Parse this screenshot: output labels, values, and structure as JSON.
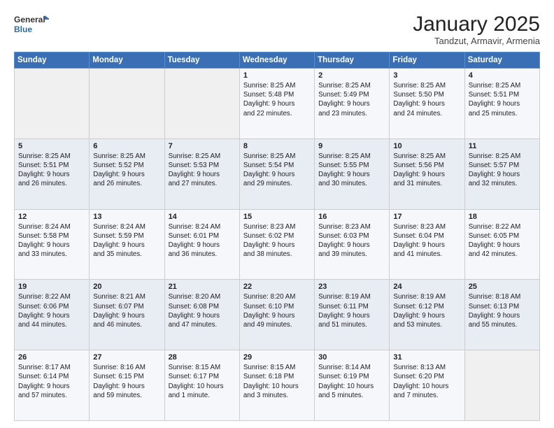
{
  "header": {
    "logo_line1": "General",
    "logo_line2": "Blue",
    "title": "January 2025",
    "subtitle": "Tandzut, Armavir, Armenia"
  },
  "weekdays": [
    "Sunday",
    "Monday",
    "Tuesday",
    "Wednesday",
    "Thursday",
    "Friday",
    "Saturday"
  ],
  "weeks": [
    [
      {
        "day": "",
        "info": ""
      },
      {
        "day": "",
        "info": ""
      },
      {
        "day": "",
        "info": ""
      },
      {
        "day": "1",
        "info": "Sunrise: 8:25 AM\nSunset: 5:48 PM\nDaylight: 9 hours\nand 22 minutes."
      },
      {
        "day": "2",
        "info": "Sunrise: 8:25 AM\nSunset: 5:49 PM\nDaylight: 9 hours\nand 23 minutes."
      },
      {
        "day": "3",
        "info": "Sunrise: 8:25 AM\nSunset: 5:50 PM\nDaylight: 9 hours\nand 24 minutes."
      },
      {
        "day": "4",
        "info": "Sunrise: 8:25 AM\nSunset: 5:51 PM\nDaylight: 9 hours\nand 25 minutes."
      }
    ],
    [
      {
        "day": "5",
        "info": "Sunrise: 8:25 AM\nSunset: 5:51 PM\nDaylight: 9 hours\nand 26 minutes."
      },
      {
        "day": "6",
        "info": "Sunrise: 8:25 AM\nSunset: 5:52 PM\nDaylight: 9 hours\nand 26 minutes."
      },
      {
        "day": "7",
        "info": "Sunrise: 8:25 AM\nSunset: 5:53 PM\nDaylight: 9 hours\nand 27 minutes."
      },
      {
        "day": "8",
        "info": "Sunrise: 8:25 AM\nSunset: 5:54 PM\nDaylight: 9 hours\nand 29 minutes."
      },
      {
        "day": "9",
        "info": "Sunrise: 8:25 AM\nSunset: 5:55 PM\nDaylight: 9 hours\nand 30 minutes."
      },
      {
        "day": "10",
        "info": "Sunrise: 8:25 AM\nSunset: 5:56 PM\nDaylight: 9 hours\nand 31 minutes."
      },
      {
        "day": "11",
        "info": "Sunrise: 8:25 AM\nSunset: 5:57 PM\nDaylight: 9 hours\nand 32 minutes."
      }
    ],
    [
      {
        "day": "12",
        "info": "Sunrise: 8:24 AM\nSunset: 5:58 PM\nDaylight: 9 hours\nand 33 minutes."
      },
      {
        "day": "13",
        "info": "Sunrise: 8:24 AM\nSunset: 5:59 PM\nDaylight: 9 hours\nand 35 minutes."
      },
      {
        "day": "14",
        "info": "Sunrise: 8:24 AM\nSunset: 6:01 PM\nDaylight: 9 hours\nand 36 minutes."
      },
      {
        "day": "15",
        "info": "Sunrise: 8:23 AM\nSunset: 6:02 PM\nDaylight: 9 hours\nand 38 minutes."
      },
      {
        "day": "16",
        "info": "Sunrise: 8:23 AM\nSunset: 6:03 PM\nDaylight: 9 hours\nand 39 minutes."
      },
      {
        "day": "17",
        "info": "Sunrise: 8:23 AM\nSunset: 6:04 PM\nDaylight: 9 hours\nand 41 minutes."
      },
      {
        "day": "18",
        "info": "Sunrise: 8:22 AM\nSunset: 6:05 PM\nDaylight: 9 hours\nand 42 minutes."
      }
    ],
    [
      {
        "day": "19",
        "info": "Sunrise: 8:22 AM\nSunset: 6:06 PM\nDaylight: 9 hours\nand 44 minutes."
      },
      {
        "day": "20",
        "info": "Sunrise: 8:21 AM\nSunset: 6:07 PM\nDaylight: 9 hours\nand 46 minutes."
      },
      {
        "day": "21",
        "info": "Sunrise: 8:20 AM\nSunset: 6:08 PM\nDaylight: 9 hours\nand 47 minutes."
      },
      {
        "day": "22",
        "info": "Sunrise: 8:20 AM\nSunset: 6:10 PM\nDaylight: 9 hours\nand 49 minutes."
      },
      {
        "day": "23",
        "info": "Sunrise: 8:19 AM\nSunset: 6:11 PM\nDaylight: 9 hours\nand 51 minutes."
      },
      {
        "day": "24",
        "info": "Sunrise: 8:19 AM\nSunset: 6:12 PM\nDaylight: 9 hours\nand 53 minutes."
      },
      {
        "day": "25",
        "info": "Sunrise: 8:18 AM\nSunset: 6:13 PM\nDaylight: 9 hours\nand 55 minutes."
      }
    ],
    [
      {
        "day": "26",
        "info": "Sunrise: 8:17 AM\nSunset: 6:14 PM\nDaylight: 9 hours\nand 57 minutes."
      },
      {
        "day": "27",
        "info": "Sunrise: 8:16 AM\nSunset: 6:15 PM\nDaylight: 9 hours\nand 59 minutes."
      },
      {
        "day": "28",
        "info": "Sunrise: 8:15 AM\nSunset: 6:17 PM\nDaylight: 10 hours\nand 1 minute."
      },
      {
        "day": "29",
        "info": "Sunrise: 8:15 AM\nSunset: 6:18 PM\nDaylight: 10 hours\nand 3 minutes."
      },
      {
        "day": "30",
        "info": "Sunrise: 8:14 AM\nSunset: 6:19 PM\nDaylight: 10 hours\nand 5 minutes."
      },
      {
        "day": "31",
        "info": "Sunrise: 8:13 AM\nSunset: 6:20 PM\nDaylight: 10 hours\nand 7 minutes."
      },
      {
        "day": "",
        "info": ""
      }
    ]
  ]
}
